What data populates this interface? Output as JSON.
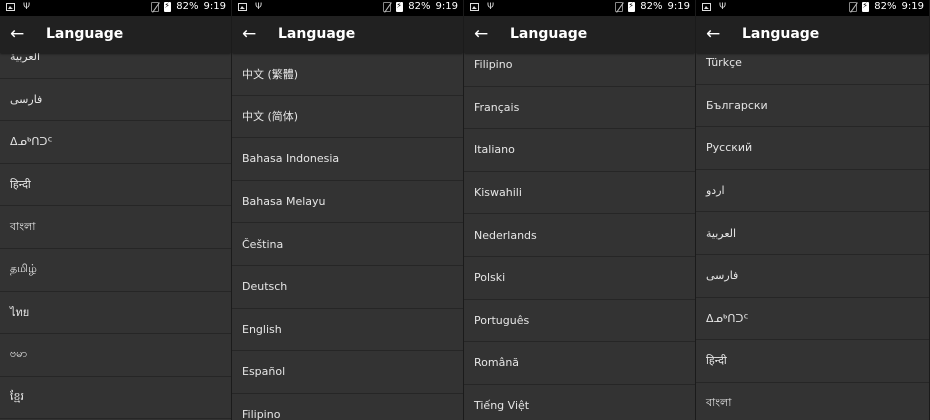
{
  "status_bar": {
    "battery": "82%",
    "time": "9:19"
  },
  "app_bar": {
    "title": "Language"
  },
  "icons": {
    "back": "arrow-back-icon",
    "usb": "usb-icon",
    "image": "image-notification-icon",
    "no_sim": "no-sim-icon",
    "battery": "battery-charging-icon"
  },
  "colors": {
    "background": "#333333",
    "app_bar": "#212121",
    "status_bar": "#000000",
    "divider": "#262626",
    "text": "#e6e6e6"
  },
  "panels": [
    {
      "items": [
        "العربية",
        "فارسی",
        "ᐃᓄᒃᑎᑐᑦ",
        "हिन्दी",
        "বাংলা",
        "தமிழ்",
        "ไทย",
        "ဗမာ",
        "ខ្មែរ"
      ]
    },
    {
      "items": [
        "中文 (繁體)",
        "中文 (简体)",
        "Bahasa Indonesia",
        "Bahasa Melayu",
        "Čeština",
        "Deutsch",
        "English",
        "Español",
        "Filipino"
      ]
    },
    {
      "items": [
        "Filipino",
        "Français",
        "Italiano",
        "Kiswahili",
        "Nederlands",
        "Polski",
        "Português",
        "Română",
        "Tiếng Việt"
      ]
    },
    {
      "items": [
        "Türkçe",
        "Български",
        "Русский",
        "اردو",
        "العربية",
        "فارسی",
        "ᐃᓄᒃᑎᑐᑦ",
        "हिन्दी",
        "বাংলা"
      ]
    }
  ]
}
